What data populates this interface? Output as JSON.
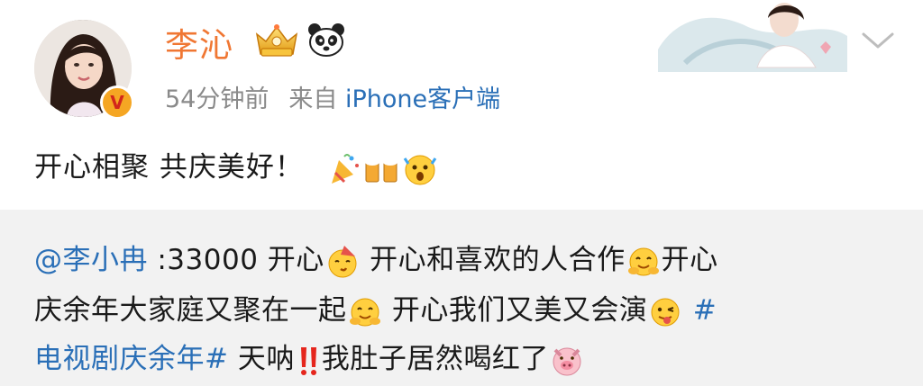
{
  "post": {
    "author": "李沁",
    "time": "54分钟前",
    "source_prefix": "来自",
    "source": "iPhone客户端",
    "text": "开心相聚 共庆美好！",
    "icons": [
      "avatar",
      "verified-badge",
      "vip-crown-icon",
      "panda-icon",
      "chevron-down-icon",
      "party-popper-icon",
      "beer-cheers-icon",
      "shocked-face-icon"
    ]
  },
  "retweet": {
    "mention": "@李小冉",
    "line1_text": " :33000 开心",
    "line1_after": " 开心和喜欢的人合作",
    "line1_end": "开心",
    "line2_text": "庆余年大家庭又聚在一起",
    "line2_after": " 开心我们又美又会演",
    "line2_hash": " #",
    "line3_topic": "电视剧庆余年#",
    "line3_text": " 天呐",
    "line3_after": "我肚子居然喝红了",
    "icons": [
      "party-face-icon",
      "hugging-face-icon",
      "winking-tongue-icon",
      "double-exclamation-icon",
      "pig-face-icon"
    ]
  },
  "colors": {
    "username": "#f07733",
    "link": "#2a6fb7",
    "meta": "#8a8a8a",
    "retweet_bg": "#f2f2f2"
  }
}
